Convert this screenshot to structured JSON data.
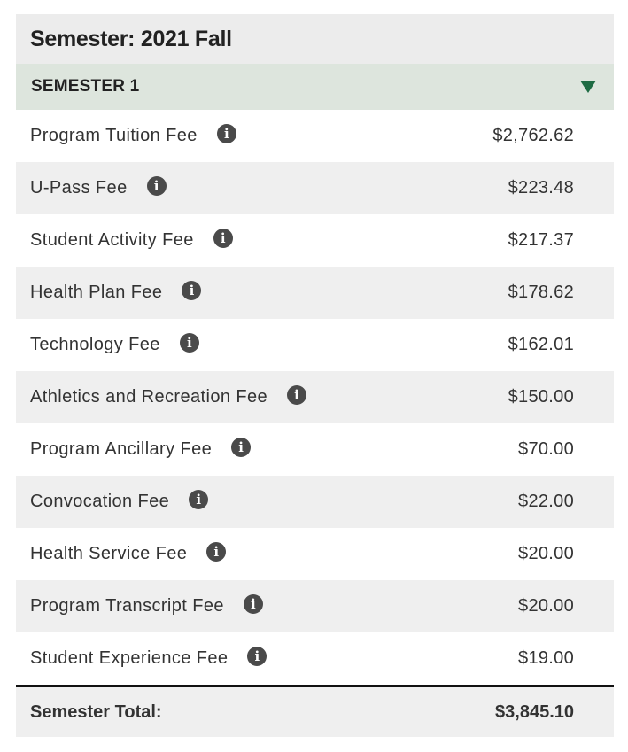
{
  "semester_title": "Semester: 2021 Fall",
  "accordion": {
    "label": "SEMESTER 1",
    "icon": "triangle-down-icon",
    "accent_color": "#1e6b43"
  },
  "fees": [
    {
      "name": "Program Tuition Fee",
      "amount": "$2,762.62"
    },
    {
      "name": "U-Pass Fee",
      "amount": "$223.48"
    },
    {
      "name": "Student Activity Fee",
      "amount": "$217.37"
    },
    {
      "name": "Health Plan Fee",
      "amount": "$178.62"
    },
    {
      "name": "Technology Fee",
      "amount": "$162.01"
    },
    {
      "name": "Athletics and Recreation Fee",
      "amount": "$150.00"
    },
    {
      "name": "Program Ancillary Fee",
      "amount": "$70.00"
    },
    {
      "name": "Convocation Fee",
      "amount": "$22.00"
    },
    {
      "name": "Health Service Fee",
      "amount": "$20.00"
    },
    {
      "name": "Program Transcript Fee",
      "amount": "$20.00"
    },
    {
      "name": "Student Experience Fee",
      "amount": "$19.00"
    }
  ],
  "total": {
    "label": "Semester Total:",
    "amount": "$3,845.10"
  },
  "info_icon_glyph": "i"
}
